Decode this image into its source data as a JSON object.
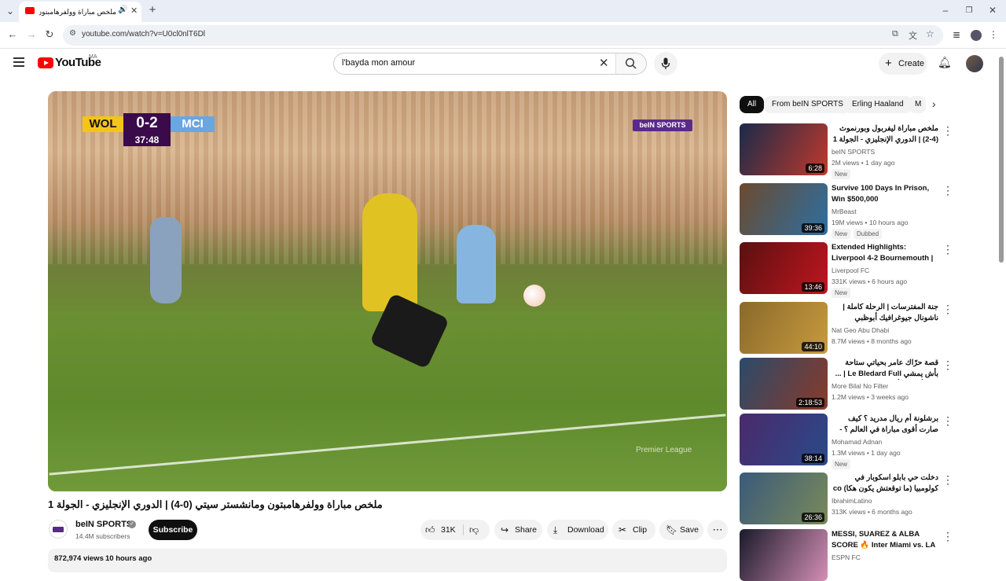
{
  "browser": {
    "tab_title": "ملخص مباراة وولفرهامبتون و",
    "url": "youtube.com/watch?v=U0cl0nlT6Dl"
  },
  "header": {
    "logo_text": "YouTube",
    "country_code": "MA",
    "search_value": "l'bayda mon amour",
    "create_label": "Create"
  },
  "player": {
    "score_home": "WOL",
    "score": "0-2",
    "score_away": "MCI",
    "clock": "37:48",
    "broadcaster": "beIN SPORTS",
    "watermark": "Premier League"
  },
  "video": {
    "title": "ملخص مباراة وولفرهامبتون ومانشستر سيتي (0-4) | الدوري الإنجليزي - الجولة 1",
    "channel": "beIN SPORTS",
    "subscribers": "14.4M subscribers",
    "subscribe_label": "Subscribe",
    "likes": "31K",
    "share_label": "Share",
    "download_label": "Download",
    "clip_label": "Clip",
    "save_label": "Save",
    "views": "872,974 views",
    "age": "10 hours ago"
  },
  "chips": [
    "All",
    "From beIN SPORTS",
    "Erling Haaland",
    "M"
  ],
  "recommendations": [
    {
      "title": "ملخص مباراة ليفربول وبورنموث (4-2) | الدوري الإنجليزي - الجولة 1",
      "channel": "beIN SPORTS",
      "meta": "2M views • 1 day ago",
      "duration": "6:28",
      "badges": [
        "New"
      ],
      "colors": [
        "#1a2a4a",
        "#c0392b"
      ]
    },
    {
      "title": "Survive 100 Days In Prison, Win $500,000",
      "channel": "MrBeast",
      "meta": "19M views • 10 hours ago",
      "duration": "39:36",
      "badges": [
        "New",
        "Dubbed"
      ],
      "colors": [
        "#6b4a2e",
        "#2d6fa3"
      ]
    },
    {
      "title": "Extended Highlights: Liverpool 4-2 Bournemouth | Ekitike, ...",
      "channel": "Liverpool FC",
      "meta": "331K views • 6 hours ago",
      "duration": "13:46",
      "badges": [
        "New"
      ],
      "colors": [
        "#5a1010",
        "#c0161f"
      ]
    },
    {
      "title": "جنة المفترسات | الرحلة كاملة | ناشونال جيوغرافيك أبوظبي",
      "channel": "Nat Geo Abu Dhabi",
      "meta": "8.7M views • 8 months ago",
      "duration": "44:10",
      "badges": [],
      "colors": [
        "#8a6a2a",
        "#c79a3e"
      ]
    },
    {
      "title": "قصة حرّاك عامر بحياتي ستاحة بأش يمشي Le Bledard Full | ... حياة أفضل فأوروبا",
      "channel": "More Bilal No Filter",
      "meta": "1.2M views • 3 weeks ago",
      "duration": "2:18:53",
      "badges": [],
      "colors": [
        "#2a4a6a",
        "#8a3a2a"
      ]
    },
    {
      "title": "برشلونة أم ريال مدريد ؟ كيف صارت أقوى مباراة في العالم ؟ - القصة الكاملة",
      "channel": "Mohamad Adnan",
      "meta": "1.3M views • 1 day ago",
      "duration": "38:14",
      "badges": [
        "New"
      ],
      "colors": [
        "#4a2a6a",
        "#2a4a8a"
      ]
    },
    {
      "title": "دخلت حي بابلو اسكوبار في كولومبيا (ما توقعتش يكون هكا) co",
      "channel": "IbrahimLatino",
      "meta": "313K views • 6 months ago",
      "duration": "26:36",
      "badges": [],
      "colors": [
        "#3a5a7a",
        "#7a8a5a"
      ]
    },
    {
      "title": "MESSI, SUAREZ & ALBA SCORE 🔥 Inter Miami vs. LA Galaxy | ...",
      "channel": "ESPN FC",
      "meta": "",
      "duration": "",
      "badges": [],
      "colors": [
        "#1a1a2a",
        "#d48fb5"
      ]
    }
  ]
}
